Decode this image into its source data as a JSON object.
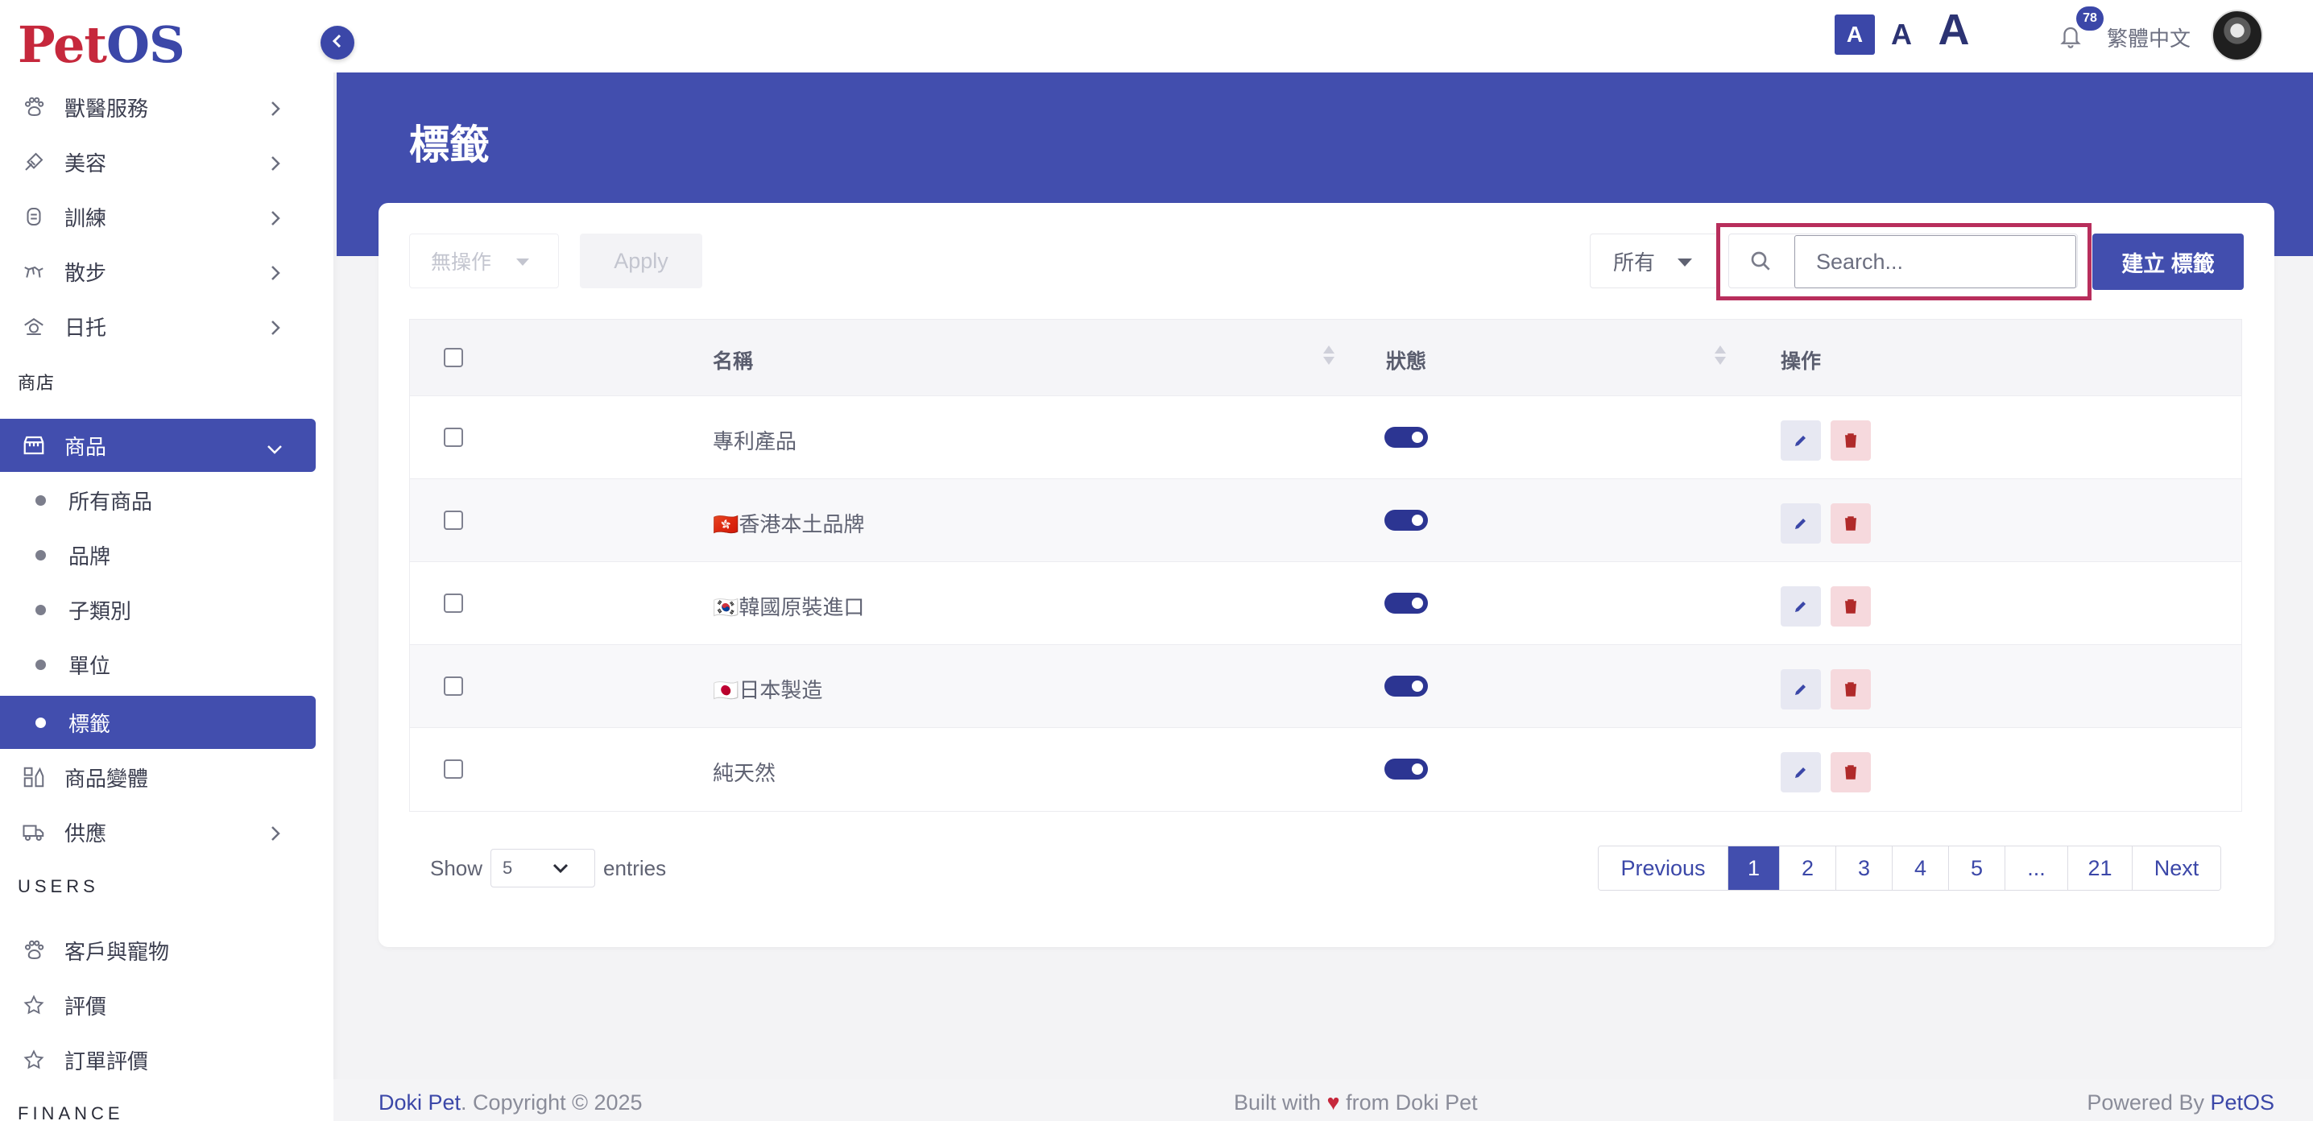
{
  "brand": {
    "logo_part1": "Pet",
    "logo_part2": "OS"
  },
  "sidebar": {
    "items_top": [
      {
        "label": "獸醫服務",
        "icon": "paw-icon"
      },
      {
        "label": "美容",
        "icon": "brush-icon"
      },
      {
        "label": "訓練",
        "icon": "dog-icon"
      },
      {
        "label": "散步",
        "icon": "walk-icon"
      },
      {
        "label": "日托",
        "icon": "daycare-icon"
      }
    ],
    "section_shop": "商店",
    "products": {
      "label": "商品",
      "icon": "store-icon"
    },
    "product_sub": [
      {
        "label": "所有商品"
      },
      {
        "label": "品牌"
      },
      {
        "label": "子類別"
      },
      {
        "label": "單位"
      },
      {
        "label": "標籤"
      }
    ],
    "variants": {
      "label": "商品變體",
      "icon": "variants-icon"
    },
    "supply": {
      "label": "供應",
      "icon": "truck-icon"
    },
    "section_users": "USERS",
    "customers": {
      "label": "客戶與寵物",
      "icon": "paw-icon"
    },
    "reviews": {
      "label": "評價",
      "icon": "star-icon"
    },
    "order_reviews": {
      "label": "訂單評價",
      "icon": "star-icon"
    },
    "section_finance": "FINANCE"
  },
  "header": {
    "font_sizes": [
      "A",
      "A",
      "A"
    ],
    "notification_count": "78",
    "language": "繁體中文"
  },
  "page": {
    "title": "標籤"
  },
  "toolbar": {
    "bulk_action": "無操作",
    "apply": "Apply",
    "status_filter": "所有",
    "search_placeholder": "Search...",
    "create": "建立 標籤"
  },
  "table": {
    "columns": {
      "name": "名稱",
      "status": "狀態",
      "actions": "操作"
    },
    "rows": [
      {
        "name": "專利產品",
        "status": true
      },
      {
        "name": "🇭🇰香港本土品牌",
        "status": true
      },
      {
        "name": "🇰🇷韓國原裝進口",
        "status": true
      },
      {
        "name": "🇯🇵日本製造",
        "status": true
      },
      {
        "name": "純天然",
        "status": true
      }
    ]
  },
  "length_menu": {
    "show": "Show",
    "value": "5",
    "entries": "entries"
  },
  "pagination": {
    "previous": "Previous",
    "pages": [
      "1",
      "2",
      "3",
      "4",
      "5",
      "...",
      "21"
    ],
    "current": "1",
    "next": "Next"
  },
  "footer": {
    "company": "Doki Pet",
    "copyright": ". Copyright © 2025",
    "built_pre": "Built with ",
    "built_post": " from Doki Pet",
    "powered_pre": "Powered By ",
    "powered_brand": "PetOS"
  },
  "colors": {
    "primary": "#424eae",
    "brand_red": "#c6283c",
    "highlight": "#b82e5c"
  }
}
